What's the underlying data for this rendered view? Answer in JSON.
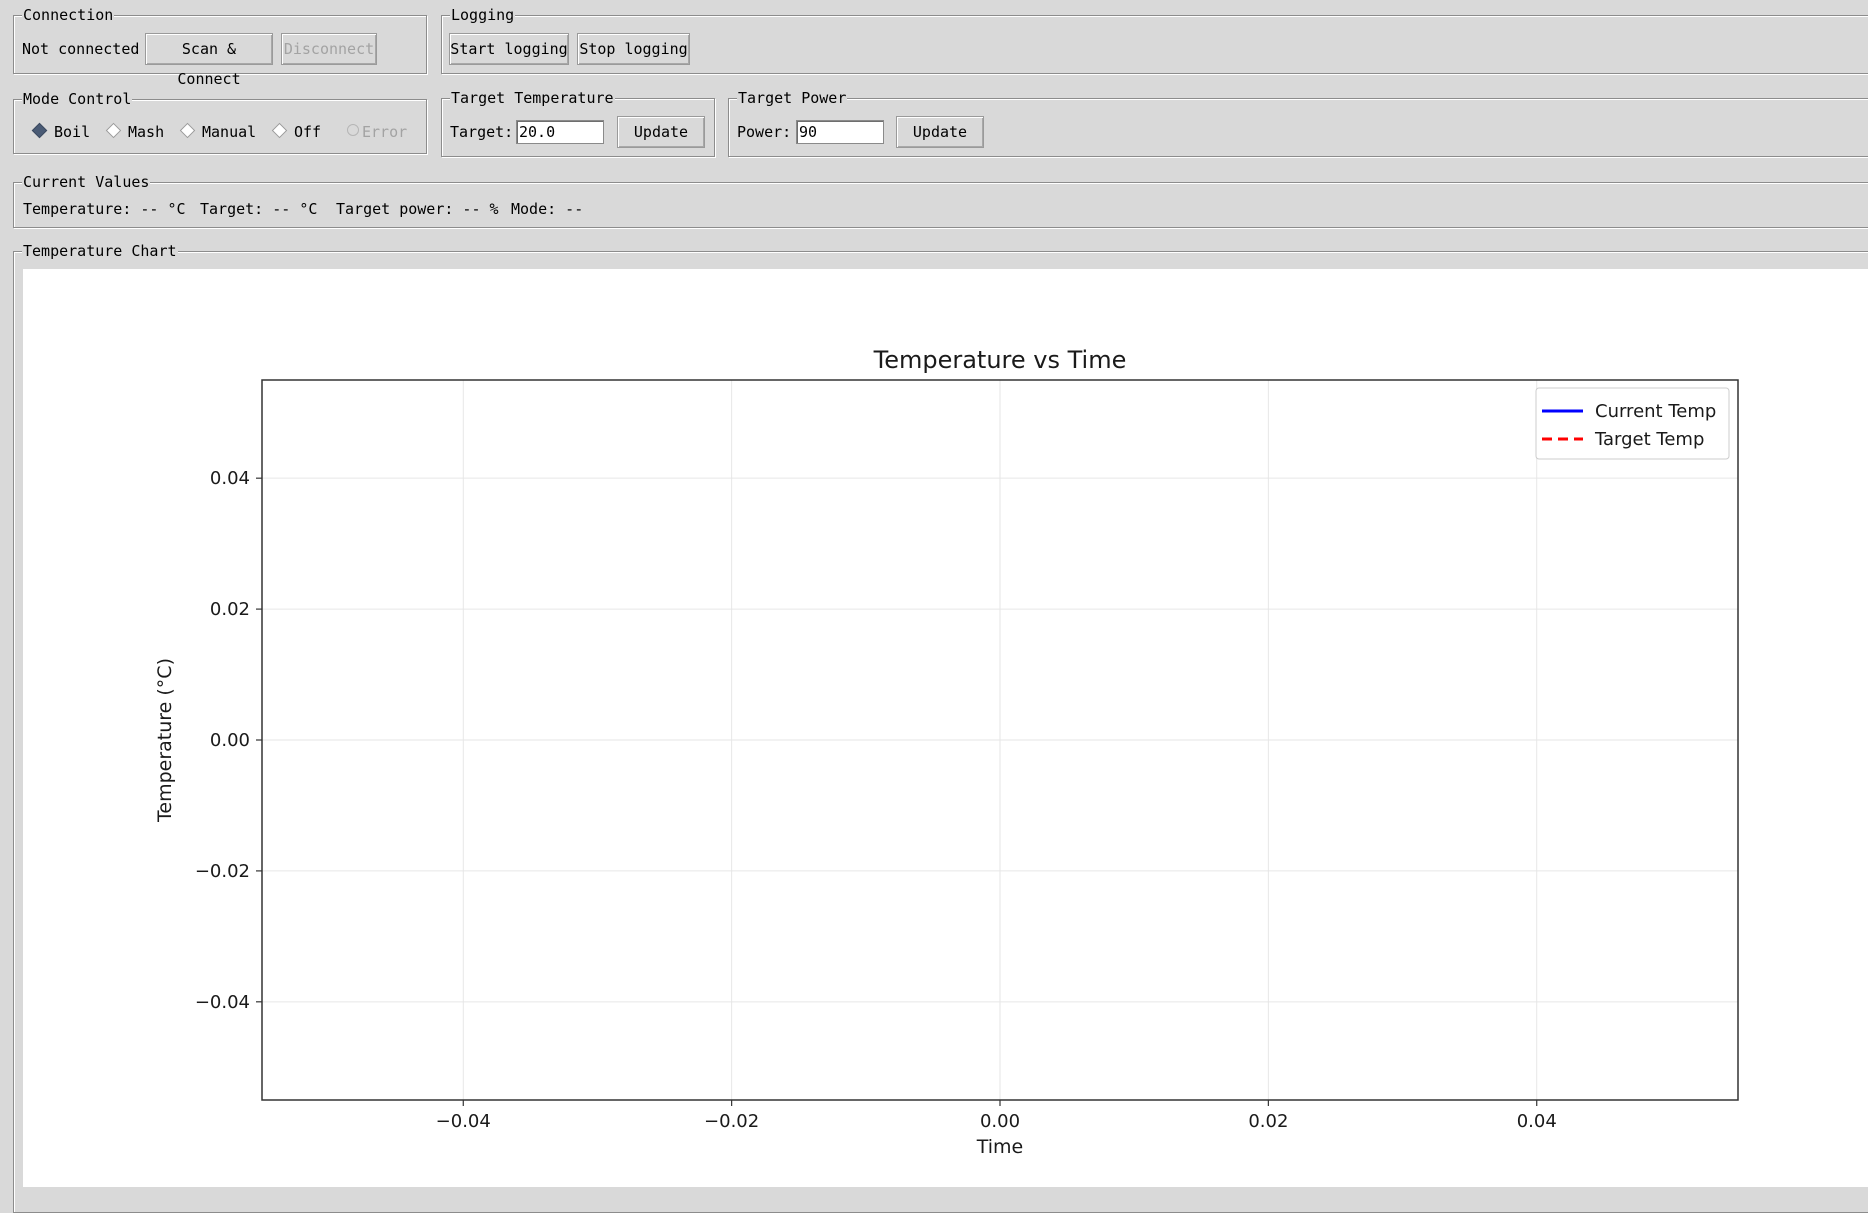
{
  "connection": {
    "title": "Connection",
    "status": "Not connected",
    "scan_label": "Scan & Connect",
    "disconnect_label": "Disconnect"
  },
  "logging": {
    "title": "Logging",
    "start_label": "Start logging",
    "stop_label": "Stop logging"
  },
  "mode_control": {
    "title": "Mode Control",
    "options": [
      {
        "label": "Boil",
        "selected": true,
        "enabled": true
      },
      {
        "label": "Mash",
        "selected": false,
        "enabled": true
      },
      {
        "label": "Manual",
        "selected": false,
        "enabled": true
      },
      {
        "label": "Off",
        "selected": false,
        "enabled": true
      },
      {
        "label": "Error",
        "selected": false,
        "enabled": false
      }
    ]
  },
  "target_temperature": {
    "title": "Target Temperature",
    "label": "Target:",
    "value": "20.0",
    "update_label": "Update"
  },
  "target_power": {
    "title": "Target Power",
    "label": "Power:",
    "value": "90",
    "update_label": "Update"
  },
  "current_values": {
    "title": "Current Values",
    "temperature": "Temperature: -- °C",
    "target": "Target: -- °C",
    "target_power": "Target power: -- %",
    "mode": "Mode: --"
  },
  "chart_panel": {
    "title": "Temperature Chart"
  },
  "chart_data": {
    "type": "line",
    "title": "Temperature vs Time",
    "xlabel": "Time",
    "ylabel": "Temperature (°C)",
    "xlim": [
      -0.055,
      0.055
    ],
    "ylim": [
      -0.055,
      0.055
    ],
    "xticks": [
      -0.04,
      -0.02,
      0.0,
      0.02,
      0.04
    ],
    "yticks": [
      -0.04,
      -0.02,
      0.0,
      0.02,
      0.04
    ],
    "xtick_labels": [
      "−0.04",
      "−0.02",
      "0.00",
      "0.02",
      "0.04"
    ],
    "ytick_labels": [
      "−0.04",
      "−0.02",
      "0.00",
      "0.02",
      "0.04"
    ],
    "grid": true,
    "legend_position": "top-right",
    "series": [
      {
        "name": "Current Temp",
        "color": "#0000ff",
        "style": "solid",
        "x": [],
        "y": []
      },
      {
        "name": "Target Temp",
        "color": "#ff0000",
        "style": "dashed",
        "x": [],
        "y": []
      }
    ]
  }
}
